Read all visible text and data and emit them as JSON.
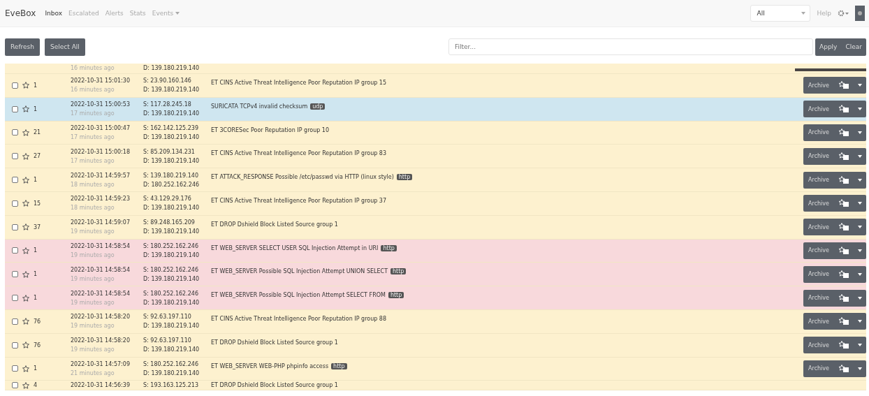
{
  "navbar": {
    "brand": "EveBox",
    "links": [
      {
        "label": "Inbox",
        "selected": true
      },
      {
        "label": "Escalated",
        "selected": false
      },
      {
        "label": "Alerts",
        "selected": false
      },
      {
        "label": "Stats",
        "selected": false
      },
      {
        "label": "Events",
        "selected": false,
        "dropdown": true
      }
    ],
    "time_range": "All",
    "help": "Help"
  },
  "toolbar": {
    "buttons": [
      "Refresh",
      "Select All"
    ],
    "filter": {
      "placeholder": "Filter..."
    },
    "filter_buttons": [
      "Apply",
      "Clear"
    ]
  },
  "rows": [
    {
      "kind": "partial",
      "color": "#fdf1cf",
      "ago": "16 minutes ago",
      "dst": "D: 139.180.219.140"
    },
    {
      "kind": "full",
      "color": "#fdf1cf",
      "checked": false,
      "count": "1",
      "timestamp": "2022-10-31 15:01:30",
      "ago": "16 minutes ago",
      "src": "S: 23.90.160.146",
      "dst": "D: 139.180.219.140",
      "message": "ET CINS Active Threat Intelligence Poor Reputation IP group 15",
      "action": "Archive"
    },
    {
      "kind": "full",
      "color": "#cfe6f0",
      "checked": false,
      "count": "1",
      "timestamp": "2022-10-31 15:00:53",
      "ago": "17 minutes ago",
      "src": "S: 117.28.245.18",
      "dst": "D: 139.180.219.140",
      "message": "SURICATA TCPv4 invalid checksum",
      "badge": "udp",
      "action": "Archive"
    },
    {
      "kind": "full",
      "color": "#fdf1cf",
      "checked": false,
      "count": "21",
      "timestamp": "2022-10-31 15:00:47",
      "ago": "17 minutes ago",
      "src": "S: 162.142.125.239",
      "dst": "D: 139.180.219.140",
      "message": "ET 3CORESec Poor Reputation IP group 10",
      "action": "Archive"
    },
    {
      "kind": "full",
      "color": "#fdf1cf",
      "checked": false,
      "count": "27",
      "timestamp": "2022-10-31 15:00:18",
      "ago": "17 minutes ago",
      "src": "S: 85.209.134.231",
      "dst": "D: 139.180.219.140",
      "message": "ET CINS Active Threat Intelligence Poor Reputation IP group 83",
      "action": "Archive"
    },
    {
      "kind": "full",
      "color": "#fdf1cf",
      "checked": false,
      "count": "1",
      "timestamp": "2022-10-31 14:59:57",
      "ago": "18 minutes ago",
      "src": "S: 139.180.219.140",
      "dst": "D: 180.252.162.246",
      "message": "ET ATTACK_RESPONSE Possible /etc/passwd via HTTP (linux style)",
      "badge": "http",
      "action": "Archive"
    },
    {
      "kind": "full",
      "color": "#fdf1cf",
      "checked": false,
      "count": "15",
      "timestamp": "2022-10-31 14:59:23",
      "ago": "18 minutes ago",
      "src": "S: 43.129.29.176",
      "dst": "D: 139.180.219.140",
      "message": "ET CINS Active Threat Intelligence Poor Reputation IP group 37",
      "action": "Archive"
    },
    {
      "kind": "full",
      "color": "#fdf1cf",
      "checked": false,
      "count": "37",
      "timestamp": "2022-10-31 14:59:07",
      "ago": "19 minutes ago",
      "src": "S: 89.248.165.209",
      "dst": "D: 139.180.219.140",
      "message": "ET DROP Dshield Block Listed Source group 1",
      "action": "Archive"
    },
    {
      "kind": "full",
      "color": "#f8d9dc",
      "checked": false,
      "count": "1",
      "timestamp": "2022-10-31 14:58:54",
      "ago": "19 minutes ago",
      "src": "S: 180.252.162.246",
      "dst": "D: 139.180.219.140",
      "message": "ET WEB_SERVER SELECT USER SQL Injection Attempt in URI",
      "badge": "http",
      "action": "Archive"
    },
    {
      "kind": "full",
      "color": "#f8d9dc",
      "checked": false,
      "count": "1",
      "timestamp": "2022-10-31 14:58:54",
      "ago": "19 minutes ago",
      "src": "S: 180.252.162.246",
      "dst": "D: 139.180.219.140",
      "message": "ET WEB_SERVER Possible SQL Injection Attempt UNION SELECT",
      "badge": "http",
      "action": "Archive"
    },
    {
      "kind": "full",
      "color": "#f8d9dc",
      "checked": false,
      "count": "1",
      "timestamp": "2022-10-31 14:58:54",
      "ago": "19 minutes ago",
      "src": "S: 180.252.162.246",
      "dst": "D: 139.180.219.140",
      "message": "ET WEB_SERVER Possible SQL Injection Attempt SELECT FROM",
      "badge": "http",
      "action": "Archive"
    },
    {
      "kind": "full",
      "color": "#fdf1cf",
      "checked": false,
      "count": "76",
      "timestamp": "2022-10-31 14:58:20",
      "ago": "19 minutes ago",
      "src": "S: 92.63.197.110",
      "dst": "D: 139.180.219.140",
      "message": "ET CINS Active Threat Intelligence Poor Reputation IP group 88",
      "action": "Archive"
    },
    {
      "kind": "full",
      "color": "#fdf1cf",
      "checked": false,
      "count": "76",
      "timestamp": "2022-10-31 14:58:20",
      "ago": "19 minutes ago",
      "src": "S: 92.63.197.110",
      "dst": "D: 139.180.219.140",
      "message": "ET DROP Dshield Block Listed Source group 1",
      "action": "Archive"
    },
    {
      "kind": "full",
      "color": "#fdf1cf",
      "checked": false,
      "count": "1",
      "timestamp": "2022-10-31 14:57:09",
      "ago": "21 minutes ago",
      "src": "S: 180.252.162.246",
      "dst": "D: 139.180.219.140",
      "message": "ET WEB_SERVER WEB-PHP phpinfo access",
      "badge": "http",
      "action": "Archive"
    },
    {
      "kind": "cut",
      "color": "#fdf1cf",
      "checked": false,
      "count": "4",
      "timestamp": "2022-10-31 14:56:39",
      "src": "S: 193.163.125.213",
      "message": "ET DROP Dshield Block Listed Source group 1"
    }
  ]
}
